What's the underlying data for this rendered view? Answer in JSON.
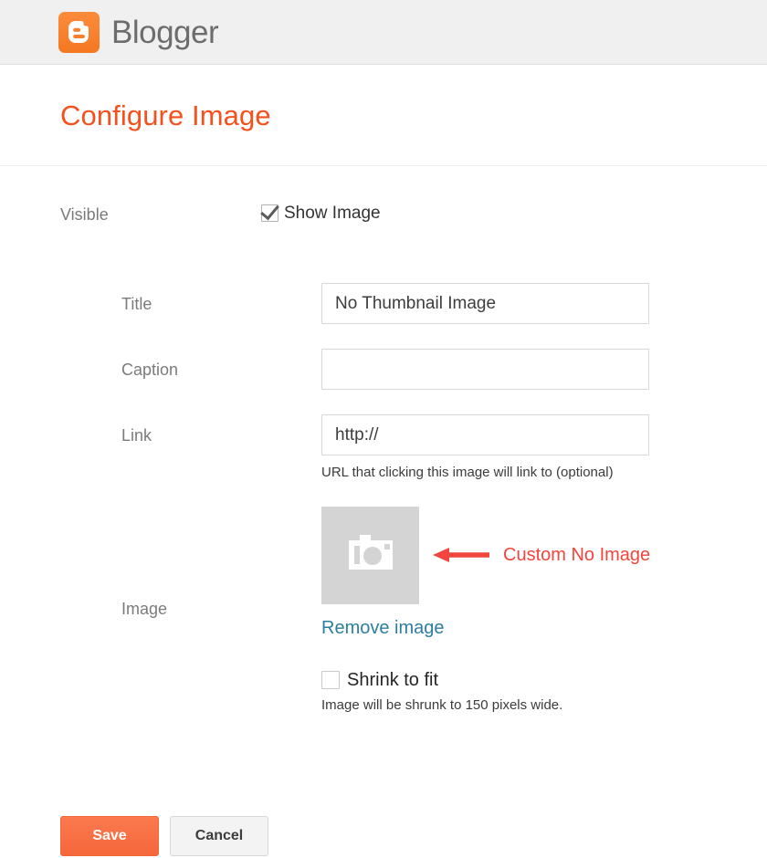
{
  "header": {
    "logo_icon": "blogger-logo-icon",
    "brand": "Blogger",
    "brand_color": "#6d6d6d",
    "logo_bg_color": "#f57722"
  },
  "page": {
    "title": "Configure Image",
    "title_color": "#f4511e"
  },
  "visible_row": {
    "label": "Visible",
    "checkbox_label": "Show Image",
    "checked": true
  },
  "fields": {
    "title": {
      "label": "Title",
      "value": "No Thumbnail Image",
      "placeholder": ""
    },
    "caption": {
      "label": "Caption",
      "value": "",
      "placeholder": ""
    },
    "link": {
      "label": "Link",
      "value": "http://",
      "placeholder": "",
      "help": "URL that clicking this image will link to (optional)"
    },
    "image": {
      "label": "Image",
      "thumbnail_icon": "camera-icon",
      "thumbnail_bg": "#d4d4d4",
      "remove_link": "Remove image",
      "remove_link_color": "#2b7f9e",
      "shrink_label": "Shrink to fit",
      "shrink_checked": false,
      "shrink_help": "Image will be shrunk to 150 pixels wide."
    }
  },
  "annotation": {
    "text": "Custom No Image",
    "color": "#f2453d",
    "arrow_icon": "left-arrow-icon"
  },
  "buttons": {
    "save": "Save",
    "cancel": "Cancel",
    "save_color": "#f4673b"
  }
}
